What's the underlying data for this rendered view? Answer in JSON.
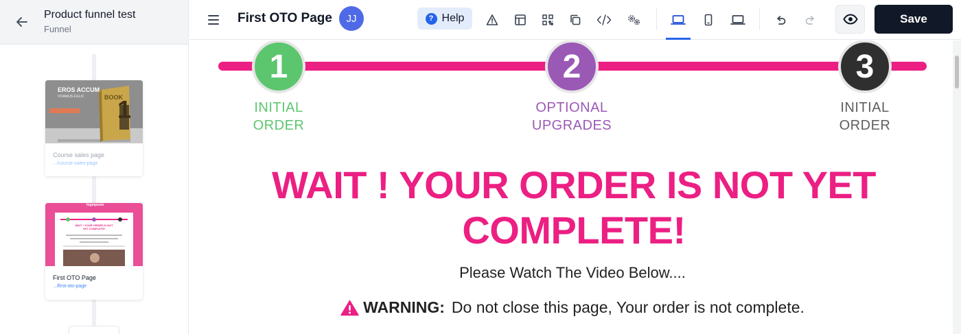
{
  "sidebar": {
    "funnel_name": "Product funnel test",
    "funnel_label": "Funnel",
    "pages": [
      {
        "name": "Course sales page",
        "slug": ".../course-sales-page",
        "thumb_title": "EROS ACCUM",
        "thumb_sub": "VIVAMUS EGLIC",
        "thumb_book": "BOOK",
        "thumb_num": "1"
      },
      {
        "name": "First OTO Page",
        "slug": ".../first-oto-page",
        "thumb_logo": "logoipsum",
        "thumb_headline": "WAIT ! YOUR ORDER IS NOT YET COMPLETE!"
      }
    ]
  },
  "topbar": {
    "page_title": "First OTO Page",
    "avatar_initials": "JJ",
    "help_label": "Help",
    "save_label": "Save",
    "icons": [
      "warning-icon",
      "layout-icon",
      "qr-code-icon",
      "copy-icon",
      "code-icon",
      "settings-icon",
      "desktop-icon",
      "mobile-icon",
      "laptop-icon",
      "undo-icon",
      "redo-icon",
      "eye-icon"
    ]
  },
  "canvas": {
    "steps": [
      {
        "number": "1",
        "line1": "INITIAL",
        "line2": "ORDER",
        "color": "#5cc66f"
      },
      {
        "number": "2",
        "line1": "OPTIONAL",
        "line2": "UPGRADES",
        "color": "#9b59b6"
      },
      {
        "number": "3",
        "line1": "INITIAL",
        "line2": "ORDER",
        "color": "#2f2f2f"
      }
    ],
    "headline_line1": "WAIT ! YOUR ORDER IS NOT YET",
    "headline_line2": "COMPLETE!",
    "subheadline": "Please Watch The Video Below....",
    "warning_label": "WARNING:",
    "warning_text": "Do not close this page, Your order is not complete."
  },
  "colors": {
    "accent_pink": "#ec1f83",
    "step1": "#5cc66f",
    "step2": "#9b59b6",
    "step3": "#2f2f2f",
    "save_bg": "#111827",
    "device_active": "#2563eb"
  }
}
